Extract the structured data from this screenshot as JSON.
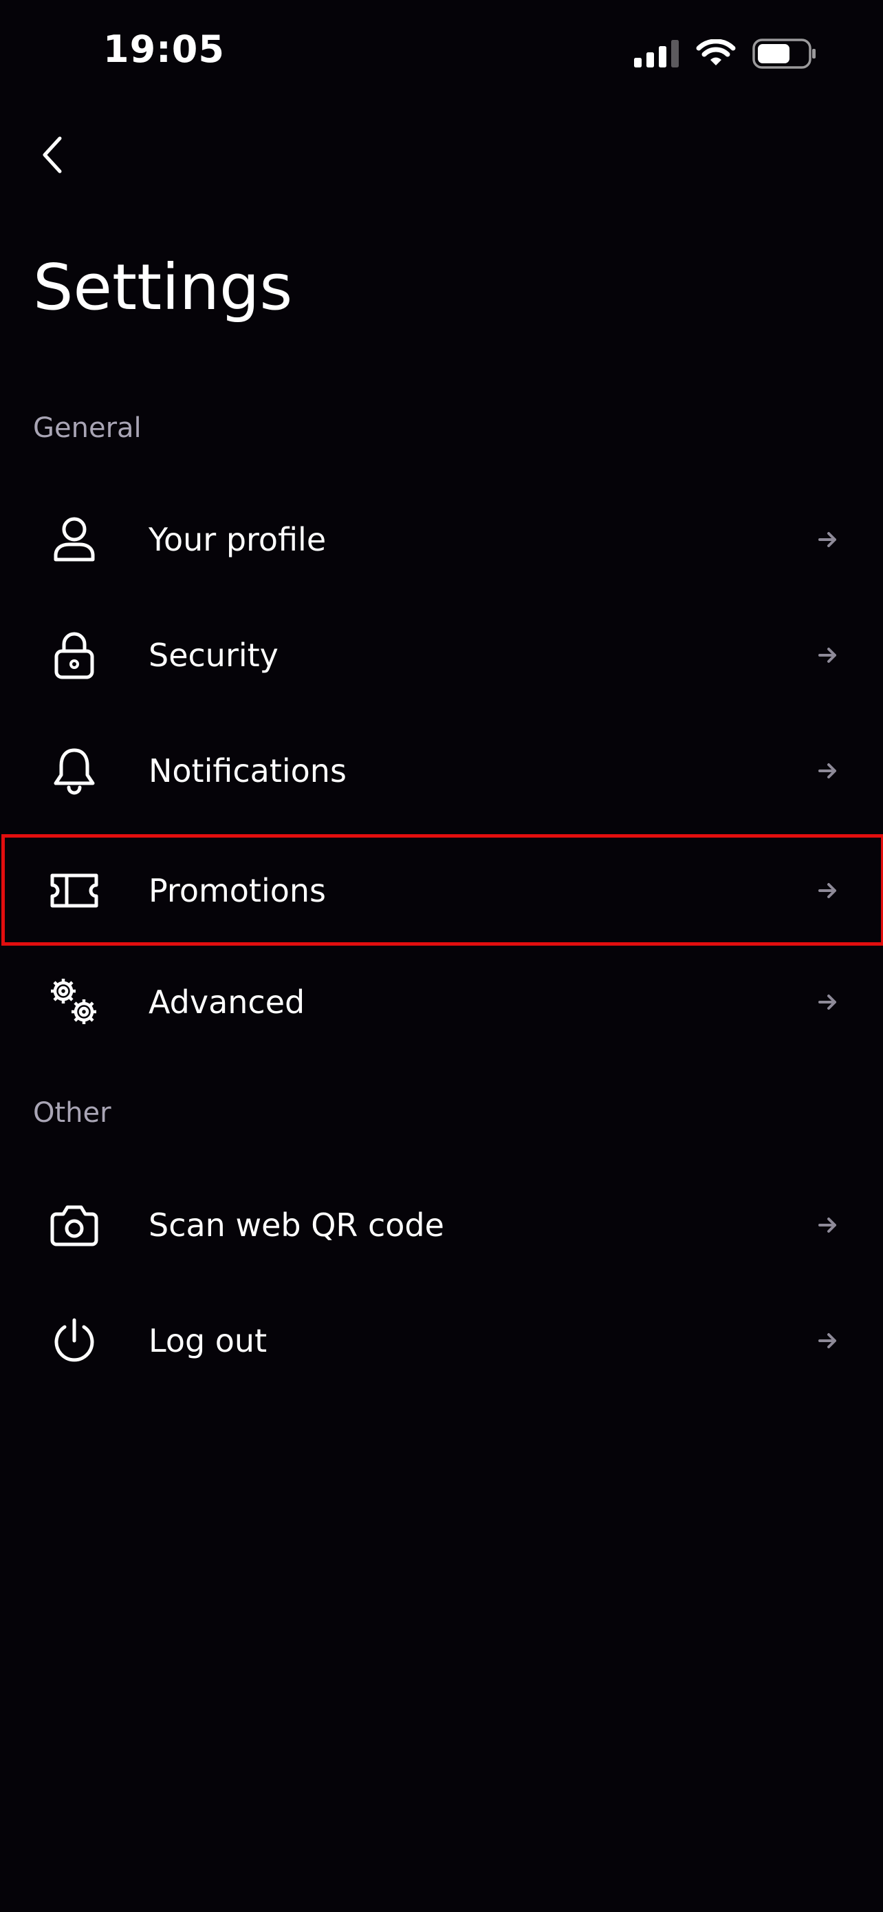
{
  "status_bar": {
    "time": "19:05",
    "icons": [
      "cellular-signal-icon",
      "wifi-icon",
      "battery-icon"
    ]
  },
  "header": {
    "back_icon": "chevron-left-icon",
    "title": "Settings"
  },
  "sections": [
    {
      "label": "General",
      "items": [
        {
          "label": "Your profile",
          "icon": "user-icon"
        },
        {
          "label": "Security",
          "icon": "lock-icon"
        },
        {
          "label": "Notifications",
          "icon": "bell-icon"
        },
        {
          "label": "Promotions",
          "icon": "ticket-icon",
          "highlighted": true
        },
        {
          "label": "Advanced",
          "icon": "gears-icon"
        }
      ]
    },
    {
      "label": "Other",
      "items": [
        {
          "label": "Scan web QR code",
          "icon": "camera-icon"
        },
        {
          "label": "Log out",
          "icon": "power-icon"
        }
      ]
    }
  ],
  "colors": {
    "background": "#050308",
    "text": "#ffffff",
    "section_label": "#a9a5b5",
    "arrow": "#8e8a98",
    "highlight_border": "#e20e0e"
  }
}
